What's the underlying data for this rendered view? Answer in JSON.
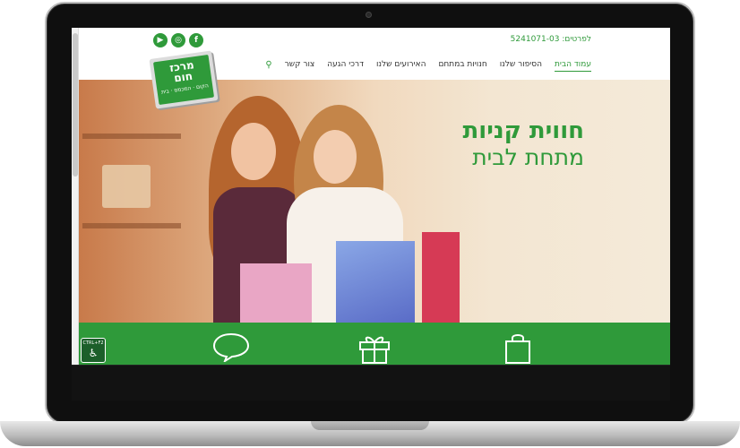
{
  "header": {
    "phone": "לפרטים: 5241071-03",
    "nav": [
      {
        "label": "עמוד הבית",
        "active": true
      },
      {
        "label": "הסיפור שלנו"
      },
      {
        "label": "חנויות במתחם"
      },
      {
        "label": "האירועים שלנו"
      },
      {
        "label": "דרכי הגעה"
      },
      {
        "label": "צור קשר"
      }
    ],
    "social": [
      "facebook-icon",
      "instagram-icon",
      "youtube-icon"
    ]
  },
  "logo": {
    "line1": "מרכז",
    "line2": "חום",
    "line3": "הקום · המכמס · בית"
  },
  "hero": {
    "title": "חווית קניות",
    "subtitle": "מתחת לבית"
  },
  "band": {
    "icons": [
      "chat-bubble-icon",
      "gift-icon",
      "shopping-bag-icon"
    ]
  },
  "accessibility": {
    "label": "CTRL+F2"
  },
  "colors": {
    "brand": "#2f9a3a"
  }
}
